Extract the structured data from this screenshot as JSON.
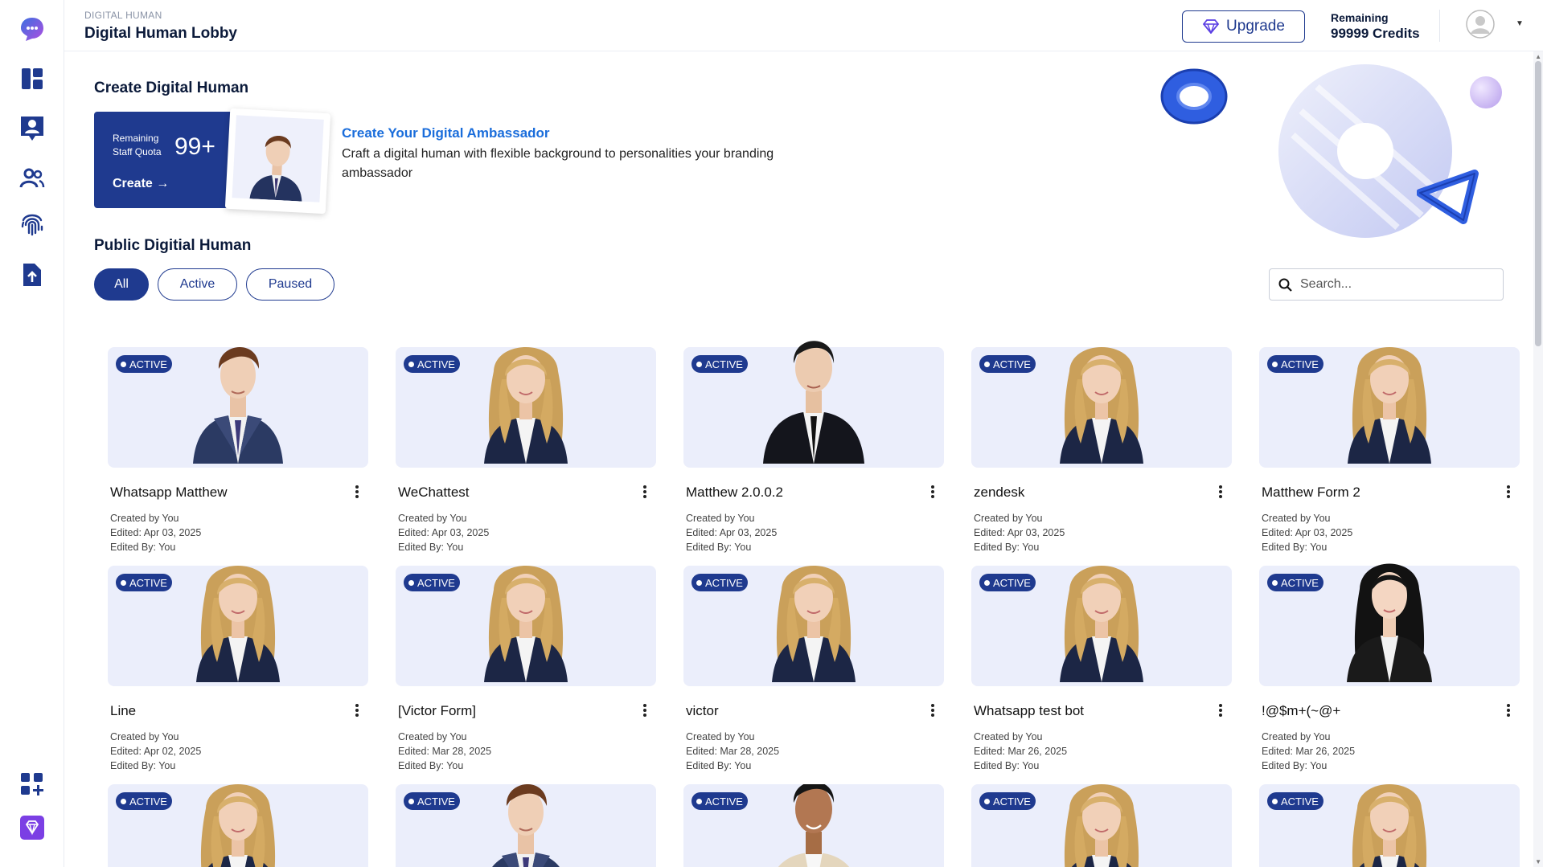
{
  "header": {
    "breadcrumb": "DIGITAL HUMAN",
    "title": "Digital Human Lobby",
    "upgrade_label": "Upgrade",
    "credits_label": "Remaining",
    "credits_value": "99999 Credits"
  },
  "sidebar": {
    "items": [
      {
        "name": "dashboard",
        "icon": "dashboard-icon"
      },
      {
        "name": "digital-human",
        "icon": "user-card-icon"
      },
      {
        "name": "users",
        "icon": "users-icon"
      },
      {
        "name": "fingerprint",
        "icon": "fingerprint-icon"
      },
      {
        "name": "upload-file",
        "icon": "file-upload-icon"
      }
    ],
    "bottom": [
      {
        "name": "add-apps",
        "icon": "apps-add-icon"
      },
      {
        "name": "premium",
        "icon": "diamond-icon"
      }
    ]
  },
  "create_section": {
    "title": "Create Digital Human",
    "quota_label_1": "Remaining",
    "quota_label_2": "Staff Quota",
    "quota_value": "99+",
    "create_label": "Create →",
    "ambassador_title": "Create Your Digital Ambassador",
    "ambassador_desc": "Craft a digital human with flexible background to personalities your branding ambassador"
  },
  "public_section": {
    "title": "Public Digitial Human",
    "filters": [
      "All",
      "Active",
      "Paused"
    ],
    "active_filter": "All",
    "search_placeholder": "Search..."
  },
  "colors": {
    "primary": "#1f3a8f",
    "link": "#1a6ddb",
    "card_bg": "#ebeefb",
    "accent_purple": "#7b3fe4"
  },
  "cards": [
    {
      "name": "Whatsapp Matthew",
      "status": "ACTIVE",
      "created": "Created by You",
      "edited": "Edited: Apr 03, 2025",
      "edited_by": "Edited By: You",
      "avatar": "young-man"
    },
    {
      "name": "WeChattest",
      "status": "ACTIVE",
      "created": "Created by You",
      "edited": "Edited: Apr 03, 2025",
      "edited_by": "Edited By: You",
      "avatar": "blonde-woman"
    },
    {
      "name": "Matthew 2.0.0.2",
      "status": "ACTIVE",
      "created": "Created by You",
      "edited": "Edited: Apr 03, 2025",
      "edited_by": "Edited By: You",
      "avatar": "dark-suit-man"
    },
    {
      "name": "zendesk",
      "status": "ACTIVE",
      "created": "Created by You",
      "edited": "Edited: Apr 03, 2025",
      "edited_by": "Edited By: You",
      "avatar": "blonde-woman"
    },
    {
      "name": "Matthew Form 2",
      "status": "ACTIVE",
      "created": "Created by You",
      "edited": "Edited: Apr 03, 2025",
      "edited_by": "Edited By: You",
      "avatar": "blonde-woman"
    },
    {
      "name": "Line",
      "status": "ACTIVE",
      "created": "Created by You",
      "edited": "Edited: Apr 02, 2025",
      "edited_by": "Edited By: You",
      "avatar": "blonde-woman"
    },
    {
      "name": "[Victor Form]",
      "status": "ACTIVE",
      "created": "Created by You",
      "edited": "Edited: Mar 28, 2025",
      "edited_by": "Edited By: You",
      "avatar": "blonde-woman"
    },
    {
      "name": "victor",
      "status": "ACTIVE",
      "created": "Created by You",
      "edited": "Edited: Mar 28, 2025",
      "edited_by": "Edited By: You",
      "avatar": "blonde-woman"
    },
    {
      "name": "Whatsapp test bot",
      "status": "ACTIVE",
      "created": "Created by You",
      "edited": "Edited: Mar 26, 2025",
      "edited_by": "Edited By: You",
      "avatar": "blonde-woman"
    },
    {
      "name": "!@$m+(~@+",
      "status": "ACTIVE",
      "created": "Created by You",
      "edited": "Edited: Mar 26, 2025",
      "edited_by": "Edited By: You",
      "avatar": "dark-hair-woman"
    },
    {
      "name": "",
      "status": "ACTIVE",
      "created": "",
      "edited": "",
      "edited_by": "",
      "avatar": "blonde-woman"
    },
    {
      "name": "",
      "status": "ACTIVE",
      "created": "",
      "edited": "",
      "edited_by": "",
      "avatar": "young-man"
    },
    {
      "name": "",
      "status": "ACTIVE",
      "created": "",
      "edited": "",
      "edited_by": "",
      "avatar": "beige-suit-man"
    },
    {
      "name": "",
      "status": "ACTIVE",
      "created": "",
      "edited": "",
      "edited_by": "",
      "avatar": "blonde-woman"
    },
    {
      "name": "",
      "status": "ACTIVE",
      "created": "",
      "edited": "",
      "edited_by": "",
      "avatar": "blonde-woman"
    }
  ]
}
